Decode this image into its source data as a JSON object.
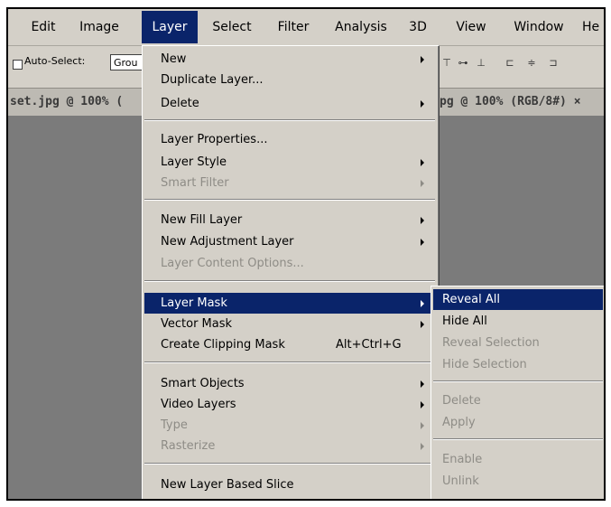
{
  "menubar": {
    "items": [
      {
        "label": "Edit"
      },
      {
        "label": "Image"
      },
      {
        "label": "Layer"
      },
      {
        "label": "Select"
      },
      {
        "label": "Filter"
      },
      {
        "label": "Analysis"
      },
      {
        "label": "3D"
      },
      {
        "label": "View"
      },
      {
        "label": "Window"
      },
      {
        "label": "He"
      }
    ]
  },
  "options_bar": {
    "auto_select_label": "Auto-Select:",
    "auto_select_checked": false,
    "group_value": "Grou"
  },
  "doc_tabs": {
    "tab1": "set.jpg @ 100% (",
    "tab2": "pg @ 100% (RGB/8#) ×"
  },
  "layer_menu": {
    "items": [
      {
        "label": "New",
        "submenu": true
      },
      {
        "label": "Duplicate Layer..."
      },
      {
        "label": "Delete",
        "submenu": true
      },
      {
        "label": "Layer Properties..."
      },
      {
        "label": "Layer Style",
        "submenu": true
      },
      {
        "label": "Smart Filter",
        "submenu": true,
        "disabled": true
      },
      {
        "label": "New Fill Layer",
        "submenu": true
      },
      {
        "label": "New Adjustment Layer",
        "submenu": true
      },
      {
        "label": "Layer Content Options...",
        "disabled": true
      },
      {
        "label": "Layer Mask",
        "submenu": true,
        "highlighted": true
      },
      {
        "label": "Vector Mask",
        "submenu": true
      },
      {
        "label": "Create Clipping Mask",
        "shortcut": "Alt+Ctrl+G"
      },
      {
        "label": "Smart Objects",
        "submenu": true
      },
      {
        "label": "Video Layers",
        "submenu": true
      },
      {
        "label": "Type",
        "submenu": true,
        "disabled": true
      },
      {
        "label": "Rasterize",
        "submenu": true,
        "disabled": true
      },
      {
        "label": "New Layer Based Slice"
      }
    ]
  },
  "layer_mask_submenu": {
    "items": [
      {
        "label": "Reveal All",
        "highlighted": true
      },
      {
        "label": "Hide All"
      },
      {
        "label": "Reveal Selection",
        "disabled": true
      },
      {
        "label": "Hide Selection",
        "disabled": true
      },
      {
        "label": "Delete",
        "disabled": true
      },
      {
        "label": "Apply",
        "disabled": true
      },
      {
        "label": "Enable",
        "disabled": true
      },
      {
        "label": "Unlink",
        "disabled": true
      }
    ]
  },
  "colors": {
    "menu_bg": "#d4d0c8",
    "highlight": "#0a246a",
    "disabled_text": "#8e8c86",
    "canvas": "#7b7b7b"
  }
}
